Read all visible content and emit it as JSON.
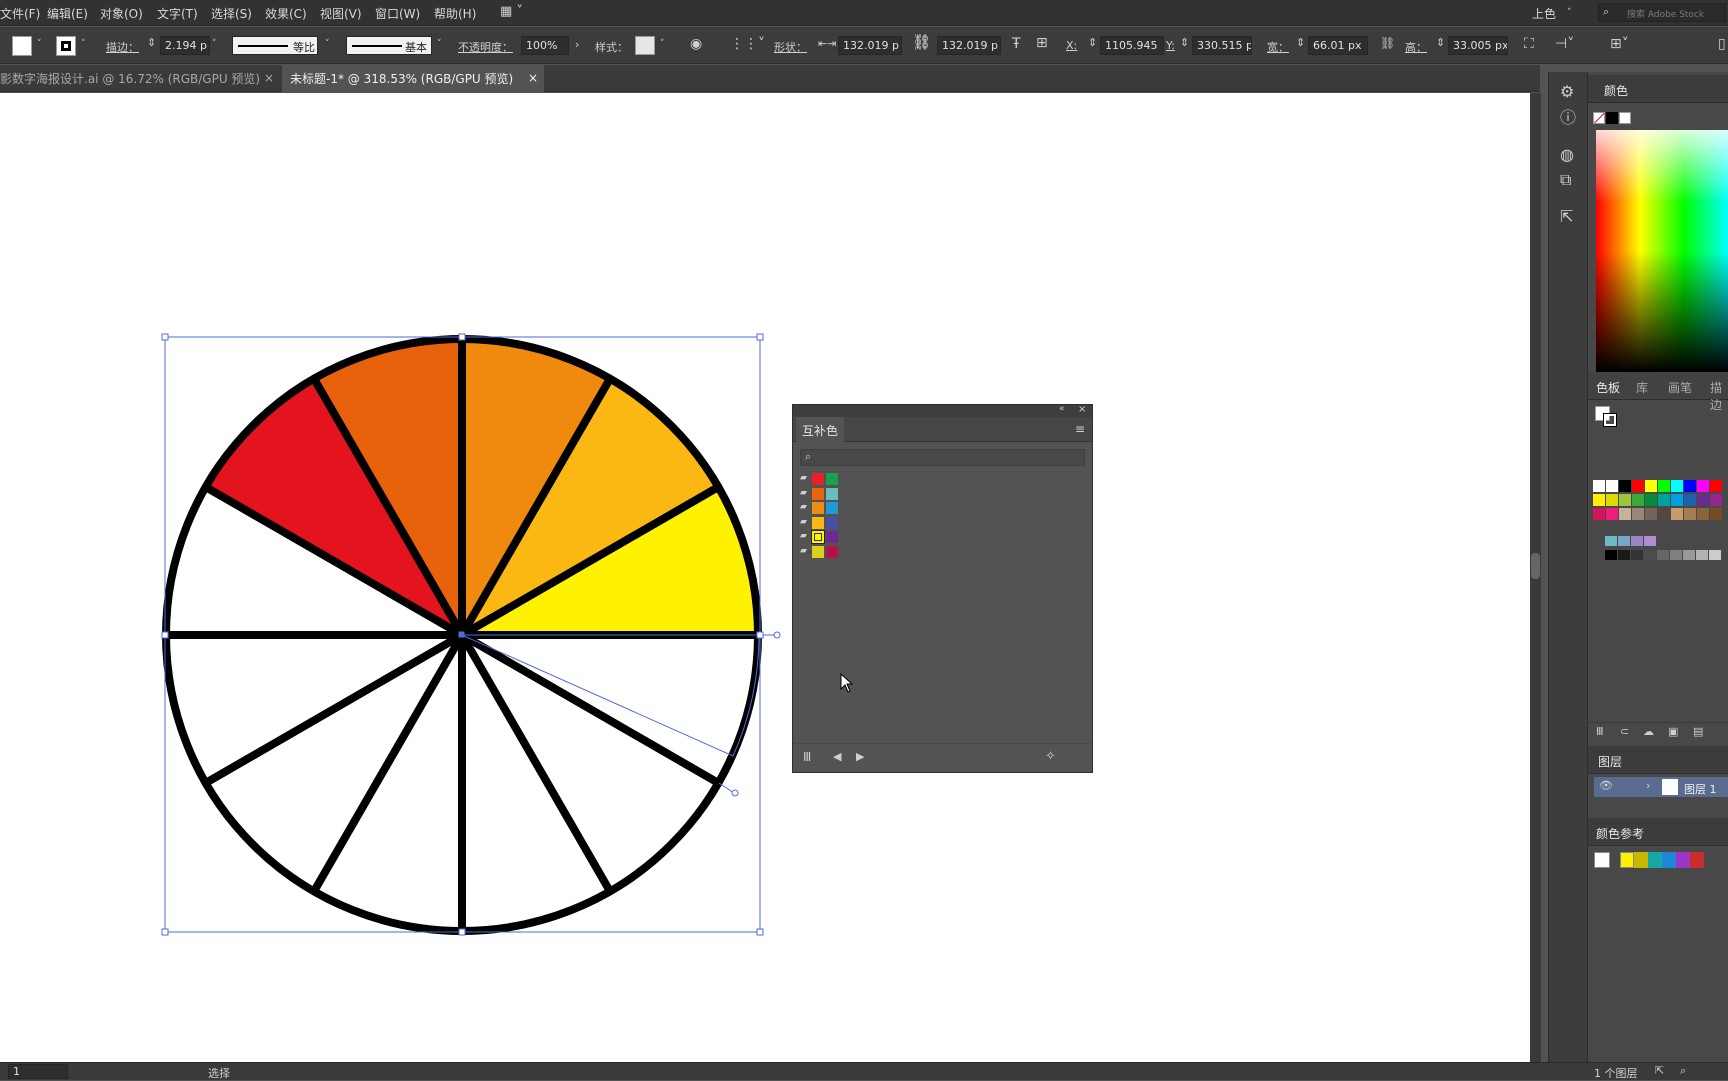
{
  "menu": [
    "文件(F)",
    "编辑(E)",
    "对象(O)",
    "文字(T)",
    "选择(S)",
    "效果(C)",
    "视图(V)",
    "窗口(W)",
    "帮助(H)"
  ],
  "workspace": "上色",
  "search_placeholder": "搜索 Adobe Stock",
  "control": {
    "stroke_label": "描边：",
    "stroke_value": "2.194 p",
    "profile_label": "等比",
    "brush_label": "基本",
    "opacity_label": "不透明度：",
    "opacity_value": "100%",
    "style_label": "样式：",
    "shape_label": "形状：",
    "shape_w": "132.019 p",
    "shape_h": "132.019 p",
    "x_label": "X:",
    "x_value": "1105.945",
    "y_label": "Y:",
    "y_value": "330.515 p",
    "w_label": "宽：",
    "w_value": "66.01 px",
    "h_label": "高：",
    "h_value": "33.005 px"
  },
  "tabs": [
    {
      "label": "影数字海报设计.ai @ 16.72% (RGB/GPU 预览)",
      "active": false
    },
    {
      "label": "未标题-1* @ 318.53% (RGB/GPU 预览)",
      "active": true
    }
  ],
  "harmony_panel": {
    "title": "互补色",
    "rows": [
      {
        "c1": "#e8202a",
        "c2": "#1aa24a"
      },
      {
        "c1": "#e9640f",
        "c2": "#6bbcc0"
      },
      {
        "c1": "#ef8c12",
        "c2": "#1c9bd7"
      },
      {
        "c1": "#fbb812",
        "c2": "#4a4ea2"
      },
      {
        "c1": "#fff200",
        "c2": "#6a2b90"
      },
      {
        "c1": "#d9d21c",
        "c2": "#b2134b"
      }
    ]
  },
  "right_panel": {
    "color_title": "颜色",
    "swatch_tabs": [
      "色板",
      "库",
      "画笔",
      "描边"
    ],
    "layers_title": "图层",
    "layer_name": "图层 1",
    "color_guide_title": "颜色参考",
    "guide_colors": [
      "#ffffff",
      "#fff200",
      "#c9b800",
      "#17a6a6",
      "#1e87d8",
      "#9b36c9",
      "#cc2b2b"
    ],
    "layer_count": "1 个图层"
  },
  "status": {
    "zoom_field": "1",
    "mode": "选择"
  },
  "wheel": {
    "colors": {
      "w1": "#f08a0f",
      "w2": "#fbb812",
      "w3": "#fff200",
      "w11": "#e8620c",
      "w10": "#e3141e"
    }
  }
}
